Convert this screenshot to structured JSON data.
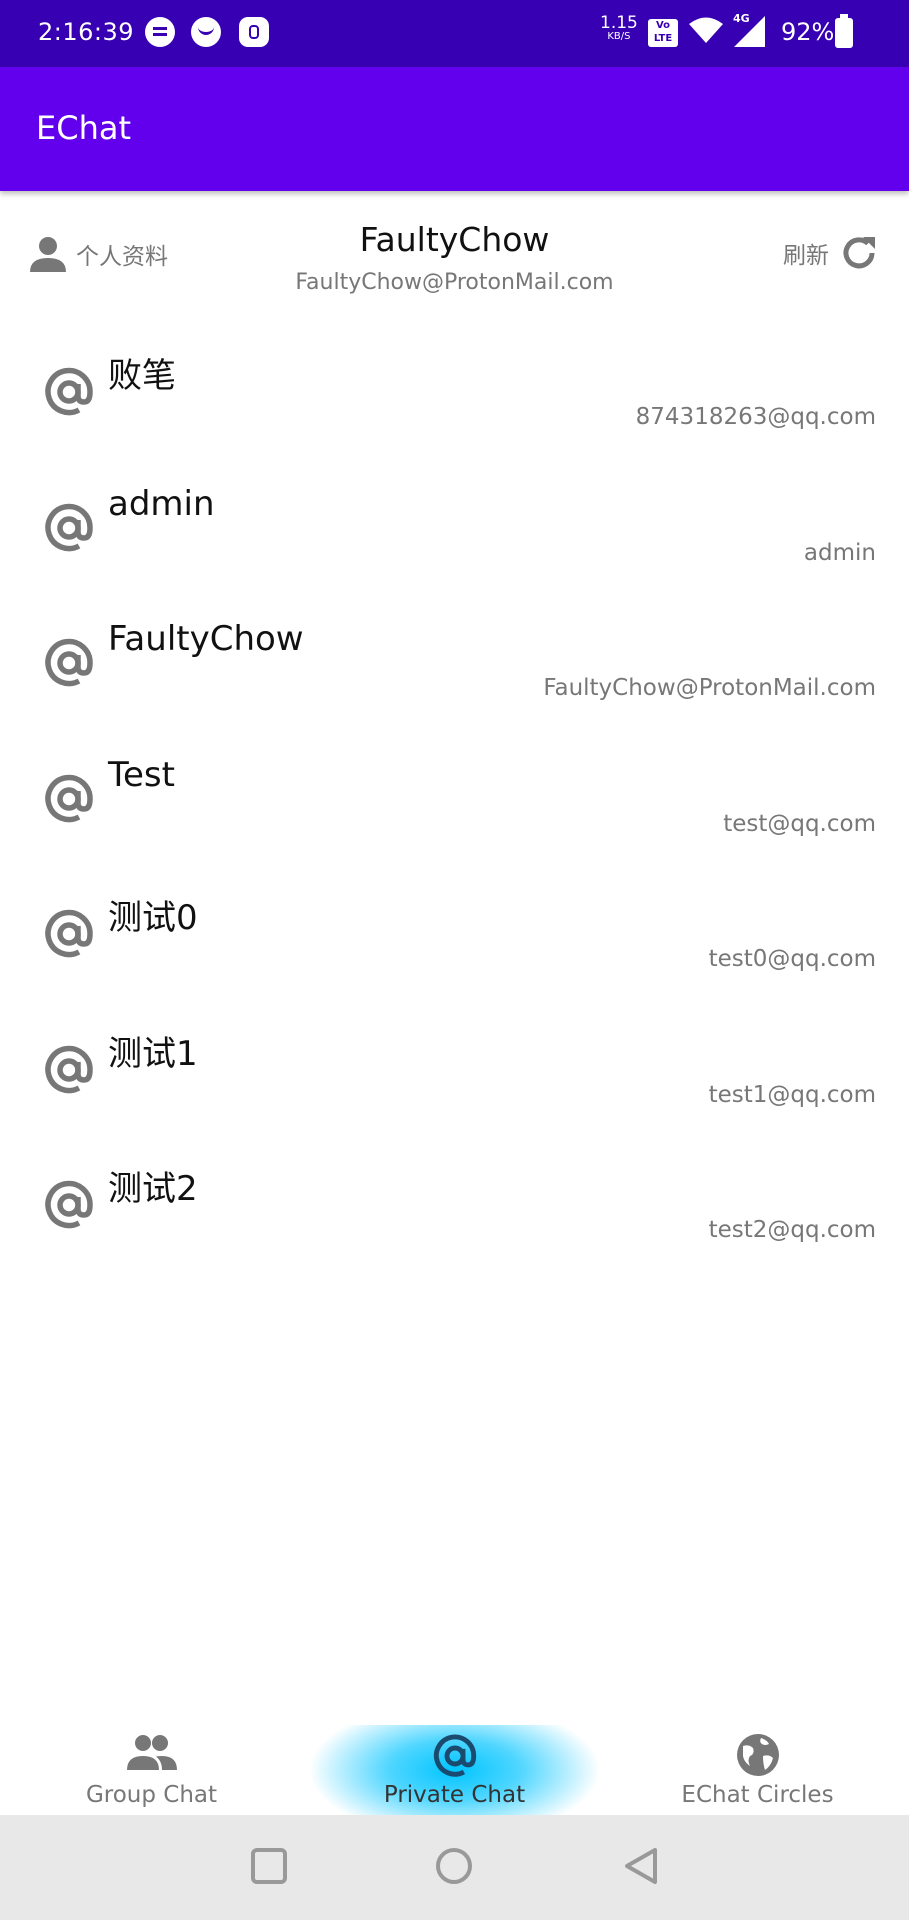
{
  "status_bar": {
    "time": "2:16:39",
    "net_speed": "1.15",
    "net_speed_unit": "KB/S",
    "volte_line1": "Vo",
    "volte_line2": "LTE",
    "network_type": "4G",
    "battery": "92%"
  },
  "app_bar": {
    "title": "EChat"
  },
  "profile": {
    "profile_label": "个人资料",
    "name": "FaultyChow",
    "email": "FaultyChow@ProtonMail.com",
    "refresh_label": "刷新"
  },
  "contacts": [
    {
      "name": "败笔",
      "email": "874318263@qq.com"
    },
    {
      "name": "admin",
      "email": "admin"
    },
    {
      "name": "FaultyChow",
      "email": "FaultyChow@ProtonMail.com"
    },
    {
      "name": "Test",
      "email": "test@qq.com"
    },
    {
      "name": "测试0",
      "email": "test0@qq.com"
    },
    {
      "name": "测试1",
      "email": "test1@qq.com"
    },
    {
      "name": "测试2",
      "email": "test2@qq.com"
    }
  ],
  "bottom_nav": {
    "items": [
      {
        "label": "Group Chat",
        "icon": "group-icon"
      },
      {
        "label": "Private Chat",
        "icon": "at-icon",
        "active": true
      },
      {
        "label": "EChat Circles",
        "icon": "globe-icon"
      }
    ]
  },
  "colors": {
    "status_bar": "#3700b3",
    "app_bar": "#6200ee",
    "active_tab_glow": "#00c4ff",
    "secondary_text": "#777777"
  }
}
